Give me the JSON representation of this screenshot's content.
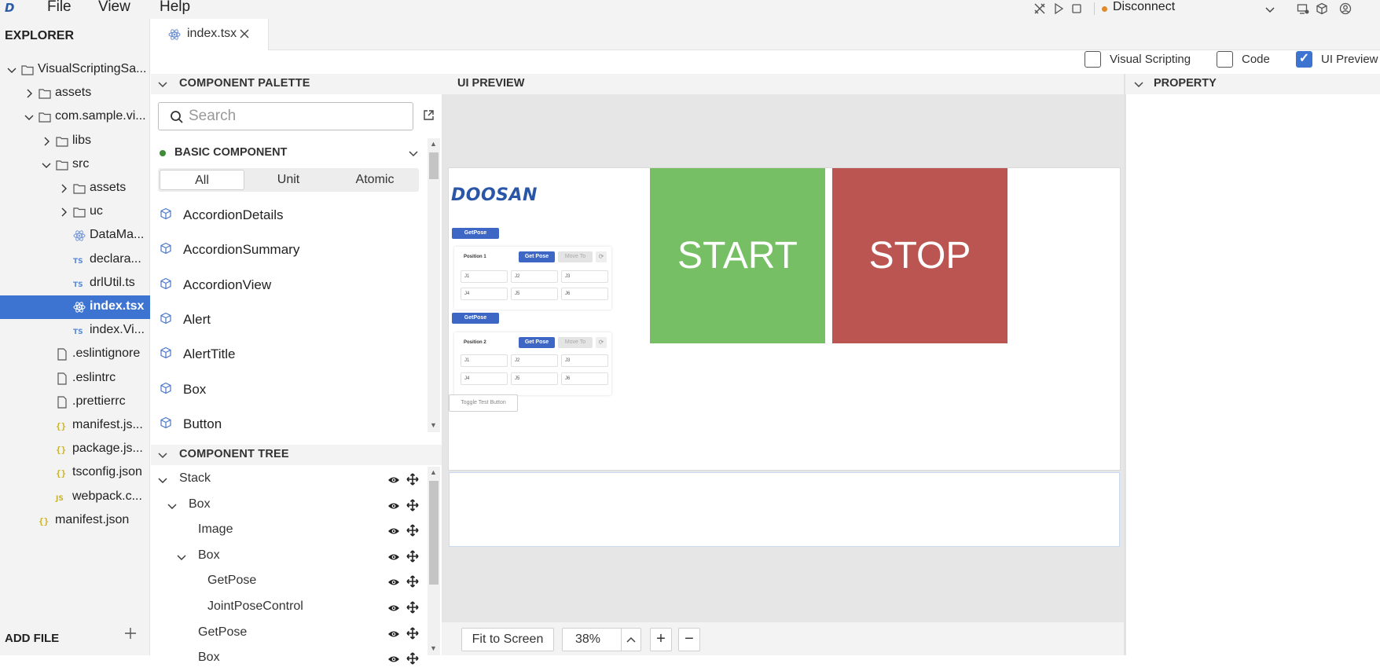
{
  "menubar": {
    "logo": "D",
    "menus": [
      "File",
      "View",
      "Help"
    ],
    "connection": {
      "label": "Disconnect",
      "dot_color": "#e08a2c"
    }
  },
  "explorer": {
    "title": "EXPLORER",
    "add_file": "ADD FILE",
    "items": [
      {
        "label": "VisualScriptingSa...",
        "kind": "folder",
        "expand": "open"
      },
      {
        "label": "assets",
        "kind": "folder",
        "expand": "closed"
      },
      {
        "label": "com.sample.vi...",
        "kind": "folder",
        "expand": "open"
      },
      {
        "label": "libs",
        "kind": "folder",
        "expand": "closed"
      },
      {
        "label": "src",
        "kind": "folder",
        "expand": "open"
      },
      {
        "label": "assets",
        "kind": "folder",
        "expand": "closed"
      },
      {
        "label": "uc",
        "kind": "folder",
        "expand": "closed"
      },
      {
        "label": "DataMa...",
        "kind": "react",
        "expand": "none"
      },
      {
        "label": "declara...",
        "kind": "ts",
        "expand": "none"
      },
      {
        "label": "drlUtil.ts",
        "kind": "ts",
        "expand": "none"
      },
      {
        "label": "index.tsx",
        "kind": "react",
        "expand": "none",
        "selected": true
      },
      {
        "label": "index.Vi...",
        "kind": "ts",
        "expand": "none"
      },
      {
        "label": ".eslintignore",
        "kind": "file",
        "expand": "none"
      },
      {
        "label": ".eslintrc",
        "kind": "file",
        "expand": "none"
      },
      {
        "label": ".prettierrc",
        "kind": "file",
        "expand": "none"
      },
      {
        "label": "manifest.js...",
        "kind": "json",
        "expand": "none"
      },
      {
        "label": "package.js...",
        "kind": "json",
        "expand": "none"
      },
      {
        "label": "tsconfig.json",
        "kind": "json",
        "expand": "none"
      },
      {
        "label": "webpack.c...",
        "kind": "js",
        "expand": "none"
      },
      {
        "label": "manifest.json",
        "kind": "json",
        "expand": "none"
      }
    ]
  },
  "editor": {
    "tab_label": "index.tsx",
    "views": [
      {
        "label": "Visual Scripting",
        "checked": false
      },
      {
        "label": "Code",
        "checked": false
      },
      {
        "label": "UI Preview",
        "checked": true
      }
    ]
  },
  "palette": {
    "title": "COMPONENT PALETTE",
    "search_placeholder": "Search",
    "group_label": "BASIC COMPONENT",
    "filters": [
      "All",
      "Unit",
      "Atomic"
    ],
    "items": [
      "AccordionDetails",
      "AccordionSummary",
      "AccordionView",
      "Alert",
      "AlertTitle",
      "Box",
      "Button"
    ]
  },
  "tree": {
    "title": "COMPONENT TREE",
    "nodes": [
      {
        "label": "Stack",
        "depth": 0,
        "expanded": true
      },
      {
        "label": "Box",
        "depth": 1,
        "expanded": true
      },
      {
        "label": "Image",
        "depth": 2,
        "expanded": false
      },
      {
        "label": "Box",
        "depth": 2,
        "expanded": true
      },
      {
        "label": "GetPose",
        "depth": 3,
        "expanded": false
      },
      {
        "label": "JointPoseControl",
        "depth": 3,
        "expanded": false
      },
      {
        "label": "GetPose",
        "depth": 2,
        "expanded": false
      },
      {
        "label": "Box",
        "depth": 2,
        "expanded": false
      }
    ]
  },
  "preview": {
    "title": "UI PREVIEW",
    "logo_text": "DOOSAN",
    "getpose_label": "GetPose",
    "card_get_pose": "Get Pose",
    "card_move_to": "Move To",
    "card_refresh": "⟳",
    "position1": "Position 1",
    "position2": "Position 2",
    "joints": [
      "J1",
      "J2",
      "J3",
      "J4",
      "J5",
      "J6"
    ],
    "toggle_label": "Toggle Test Button",
    "start_label": "START",
    "stop_label": "STOP",
    "start_color": "#77bf65",
    "stop_color": "#bb5551",
    "fit_label": "Fit to Screen",
    "zoom": "38%",
    "zoom_in": "+",
    "zoom_out": "−"
  },
  "property": {
    "title": "PROPERTY"
  }
}
